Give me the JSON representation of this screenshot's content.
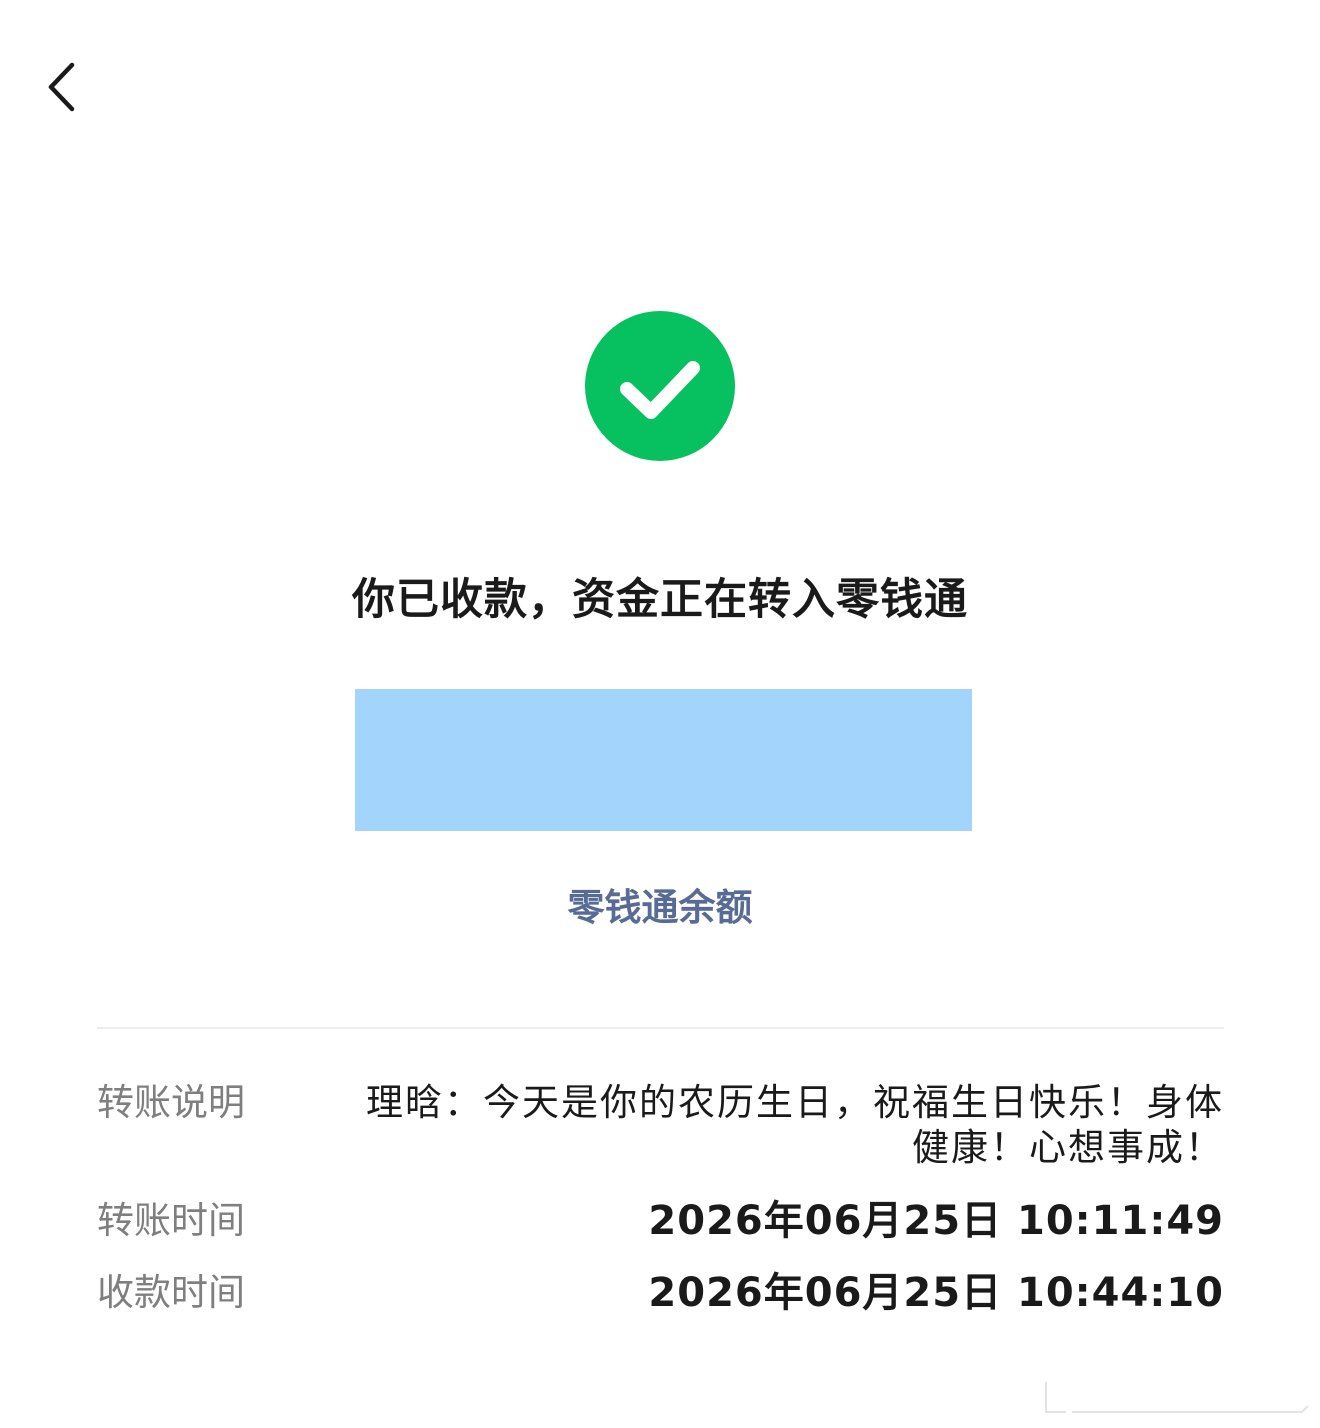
{
  "nav": {
    "back_icon": "chevron-left-icon"
  },
  "status": {
    "icon": "check-circle-icon",
    "icon_color": "#07c160",
    "title": "你已收款，资金正在转入零钱通"
  },
  "amount": {
    "redaction_color": "#a2d4fc"
  },
  "balance_link": {
    "label": "零钱通余额",
    "color": "#576b95"
  },
  "details": {
    "note": {
      "label": "转账说明",
      "value": "理晗：今天是你的农历生日，祝福生日快乐！身体健康！心想事成！"
    },
    "transfer_time": {
      "label": "转账时间",
      "value": "2026年06月25日 10:11:49"
    },
    "receive_time": {
      "label": "收款时间",
      "value": "2026年06月25日 10:44:10"
    }
  }
}
